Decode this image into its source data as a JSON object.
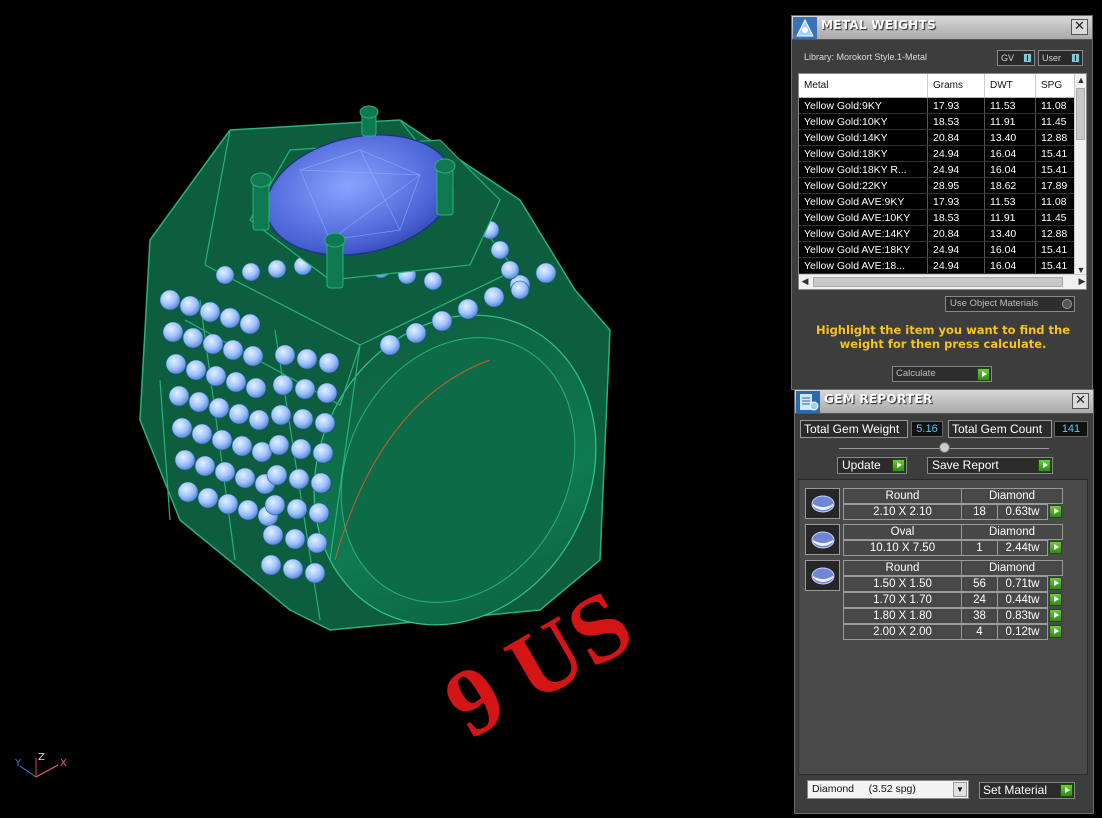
{
  "viewport": {
    "ring_size_text": "9 US",
    "axis": {
      "y": "Y",
      "z": "Z",
      "x": "X"
    }
  },
  "metal_weights": {
    "title": "METAL WEIGHTS",
    "library_label": "Library: Morokort Style.1-Metal",
    "toggle_gv": "GV",
    "toggle_user": "User",
    "columns": [
      "Metal",
      "Grams",
      "DWT",
      "SPG"
    ],
    "rows": [
      [
        "Yellow Gold:9KY",
        "17.93",
        "11.53",
        "11.08"
      ],
      [
        "Yellow Gold:10KY",
        "18.53",
        "11.91",
        "11.45"
      ],
      [
        "Yellow Gold:14KY",
        "20.84",
        "13.40",
        "12.88"
      ],
      [
        "Yellow Gold:18KY",
        "24.94",
        "16.04",
        "15.41"
      ],
      [
        "Yellow Gold:18KY R...",
        "24.94",
        "16.04",
        "15.41"
      ],
      [
        "Yellow Gold:22KY",
        "28.95",
        "18.62",
        "17.89"
      ],
      [
        "Yellow Gold AVE:9KY",
        "17.93",
        "11.53",
        "11.08"
      ],
      [
        "Yellow Gold AVE:10KY",
        "18.53",
        "11.91",
        "11.45"
      ],
      [
        "Yellow Gold AVE:14KY",
        "20.84",
        "13.40",
        "12.88"
      ],
      [
        "Yellow Gold AVE:18KY",
        "24.94",
        "16.04",
        "15.41"
      ],
      [
        "Yellow Gold AVE:18...",
        "24.94",
        "16.04",
        "15.41"
      ]
    ],
    "use_object_materials": "Use Object Materials",
    "hint": "Highlight the item you want to find the weight for then press calculate.",
    "calculate_label": "Calculate"
  },
  "gem_reporter": {
    "title": "GEM REPORTER",
    "total_weight_label": "Total Gem Weight",
    "total_weight_value": "5.16",
    "total_count_label": "Total Gem Count",
    "total_count_value": "141",
    "update_label": "Update",
    "save_report_label": "Save Report",
    "groups": [
      {
        "shape": "Round",
        "material": "Diamond",
        "rows": [
          [
            "2.10 X 2.10",
            "18",
            "0.63tw"
          ]
        ]
      },
      {
        "shape": "Oval",
        "material": "Diamond",
        "rows": [
          [
            "10.10 X 7.50",
            "1",
            "2.44tw"
          ]
        ]
      },
      {
        "shape": "Round",
        "material": "Diamond",
        "rows": [
          [
            "1.50 X 1.50",
            "56",
            "0.71tw"
          ],
          [
            "1.70 X 1.70",
            "24",
            "0.44tw"
          ],
          [
            "1.80 X 1.80",
            "38",
            "0.83tw"
          ],
          [
            "2.00 X 2.00",
            "4",
            "0.12tw"
          ]
        ]
      }
    ],
    "material_select": "Diamond     (3.52 spg)",
    "set_material_label": "Set Material"
  },
  "colors": {
    "ring_green": "#0f6e4a",
    "gem_blue": "#9cc3ff",
    "center_stone": "#4f6fe0",
    "size_text_red": "#d41515",
    "hint_yellow": "#f6c321",
    "value_cyan": "#4fd1ee"
  }
}
